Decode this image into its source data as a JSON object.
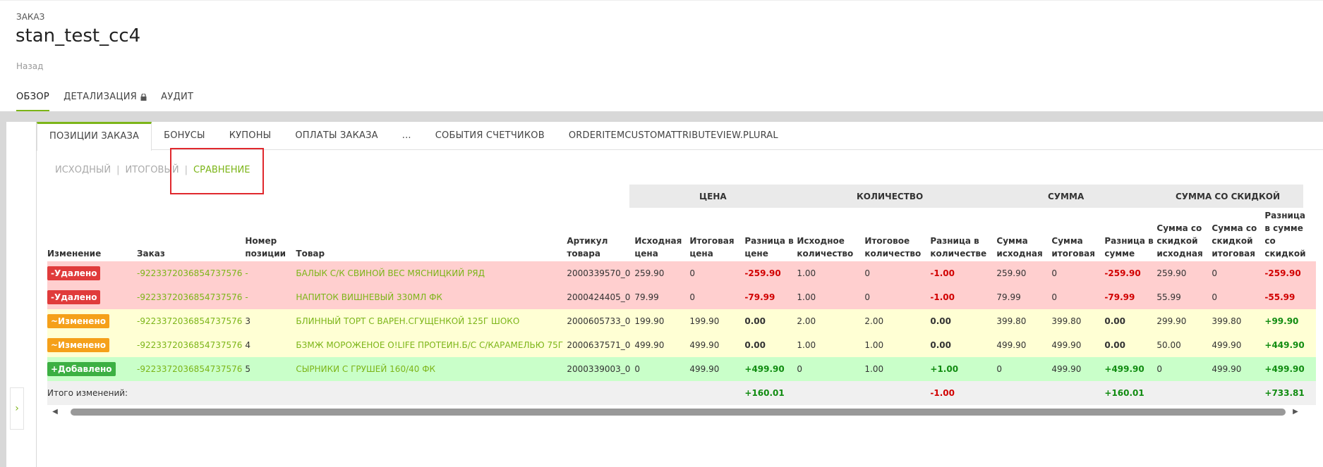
{
  "header": {
    "crumb": "ЗАКАЗ",
    "title": "stan_test_cc4",
    "back": "Назад",
    "tabs": [
      {
        "label": "ОБЗОР"
      },
      {
        "label": "ДЕТАЛИЗАЦИЯ"
      },
      {
        "label": "АУДИТ"
      }
    ]
  },
  "sub_tabs": [
    "ПОЗИЦИИ ЗАКАЗА",
    "БОНУСЫ",
    "КУПОНЫ",
    "ОПЛАТЫ ЗАКАЗА",
    "...",
    "СОБЫТИЯ СЧЕТЧИКОВ",
    "ORDERITEMCUSTOMATTRIBUTEVIEW.PLURAL"
  ],
  "view_switch": {
    "original": "ИСХОДНЫЙ",
    "final": "ИТОГОВЫЙ",
    "compare": "СРАВНЕНИЕ"
  },
  "groups": {
    "price": "ЦЕНА",
    "qty": "КОЛИЧЕСТВО",
    "sum": "СУММА",
    "sum_discount": "СУММА СО СКИДКОЙ"
  },
  "columns": [
    "Изменение",
    "Заказ",
    "Номер позиции",
    "Товар",
    "Артикул товара",
    "Исходная цена",
    "Итоговая цена",
    "Разница в цене",
    "Исходное количество",
    "Итоговое количество",
    "Разница в количестве",
    "Сумма исходная",
    "Сумма итоговая",
    "Разница в сумме",
    "Сумма со скидкой исходная",
    "Сумма со скидкой итоговая",
    "Разница в сумме со скидкой"
  ],
  "rows": [
    {
      "kind": "deleted",
      "badge": "-Удалено",
      "order": "-9223372036854737576",
      "pos": "-",
      "product": "БАЛЫК С/К СВИНОЙ ВЕС МЯСНИЦКИЙ РЯД",
      "sku": "2000339570_0",
      "p1": "259.90",
      "p2": "0",
      "pd": "-259.90",
      "q1": "1.00",
      "q2": "0",
      "qd": "-1.00",
      "s1": "259.90",
      "s2": "0",
      "sd": "-259.90",
      "d1": "259.90",
      "d2": "0",
      "dd": "-259.90"
    },
    {
      "kind": "deleted",
      "badge": "-Удалено",
      "order": "-9223372036854737576",
      "pos": "-",
      "product": "НАПИТОК ВИШНЕВЫЙ 330МЛ ФК",
      "sku": "2000424405_0",
      "p1": "79.99",
      "p2": "0",
      "pd": "-79.99",
      "q1": "1.00",
      "q2": "0",
      "qd": "-1.00",
      "s1": "79.99",
      "s2": "0",
      "sd": "-79.99",
      "d1": "55.99",
      "d2": "0",
      "dd": "-55.99"
    },
    {
      "kind": "changed",
      "badge": "~Изменено",
      "order": "-9223372036854737576",
      "pos": "3",
      "product": "БЛИННЫЙ ТОРТ С ВАРЕН.СГУЩЕНКОЙ 125Г ШОКО",
      "sku": "2000605733_0",
      "p1": "199.90",
      "p2": "199.90",
      "pd": "0.00",
      "q1": "2.00",
      "q2": "2.00",
      "qd": "0.00",
      "s1": "399.80",
      "s2": "399.80",
      "sd": "0.00",
      "d1": "299.90",
      "d2": "399.80",
      "dd": "+99.90"
    },
    {
      "kind": "changed",
      "badge": "~Изменено",
      "order": "-9223372036854737576",
      "pos": "4",
      "product": "БЗМЖ МОРОЖЕНОЕ O!LIFE ПРОТЕИН.Б/С С/КАРАМЕЛЬЮ 75Г",
      "sku": "2000637571_0",
      "p1": "499.90",
      "p2": "499.90",
      "pd": "0.00",
      "q1": "1.00",
      "q2": "1.00",
      "qd": "0.00",
      "s1": "499.90",
      "s2": "499.90",
      "sd": "0.00",
      "d1": "50.00",
      "d2": "499.90",
      "dd": "+449.90"
    },
    {
      "kind": "added",
      "badge": "+Добавлено",
      "order": "-9223372036854737576",
      "pos": "5",
      "product": "СЫРНИКИ С ГРУШЕЙ 160/40 ФК",
      "sku": "2000339003_0",
      "p1": "0",
      "p2": "499.90",
      "pd": "+499.90",
      "q1": "0",
      "q2": "1.00",
      "qd": "+1.00",
      "s1": "0",
      "s2": "499.90",
      "sd": "+499.90",
      "d1": "0",
      "d2": "499.90",
      "dd": "+499.90"
    }
  ],
  "totals": {
    "label": "Итого изменений:",
    "pd": "+160.01",
    "qd": "-1.00",
    "sd": "+160.01",
    "dd": "+733.81"
  },
  "colors": {
    "accent": "#7cb518",
    "deleted": "#ffcfcf",
    "changed": "#ffffd4",
    "added": "#c9ffc9",
    "highlight": "#e0282d"
  }
}
